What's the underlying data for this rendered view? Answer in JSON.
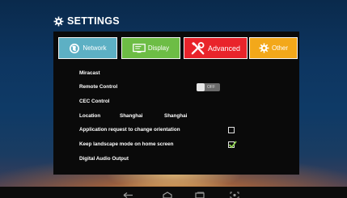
{
  "header": {
    "title": "SETTINGS",
    "icon": "gear-icon"
  },
  "tabs": [
    {
      "label": "Network",
      "icon": "globe-icon",
      "color": "#5db0c4"
    },
    {
      "label": "Display",
      "icon": "monitor-icon",
      "color": "#6dbd45"
    },
    {
      "label": "Advanced",
      "icon": "tools-icon",
      "color": "#e9242b",
      "selected": true
    },
    {
      "label": "Other",
      "icon": "gear-icon",
      "color": "#f3a81a"
    }
  ],
  "settings": {
    "miracast": "Miracast",
    "remote_control": {
      "label": "Remote Control",
      "toggle": "OFF"
    },
    "cec_control": "CEC Control",
    "location": {
      "label": "Location",
      "value1": "Shanghai",
      "value2": "Shanghai"
    },
    "orientation_request": {
      "label": "Application request to change orientation",
      "checked": false
    },
    "landscape_home": {
      "label": "Keep landscape mode on home screen",
      "checked": true
    },
    "digital_audio": "Digital Audio Output"
  },
  "navbar": {
    "buttons": [
      "back-icon",
      "home-icon",
      "recents-icon",
      "screenshot-icon"
    ]
  },
  "colors": {
    "panel_bg": "#0a0a0a",
    "check_color": "#8fd14f"
  }
}
